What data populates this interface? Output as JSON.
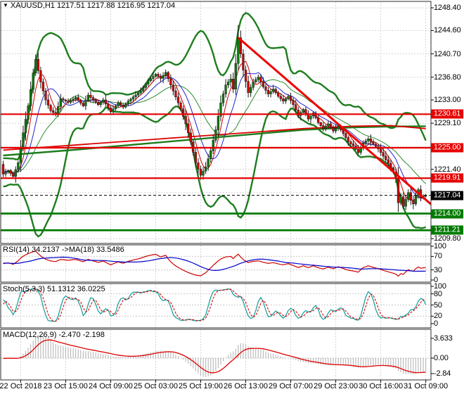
{
  "window": {
    "symbol_header": "XAUUSD,H1 1217.51 1217.88 1216.95 1217.04"
  },
  "colors": {
    "grid": "#d4d4d4",
    "pane_border": "#2b2b2b",
    "level_red": "#e60000",
    "level_green": "#007a00",
    "trendline_red": "#f00000",
    "bollinger_green": "#1e7d1e",
    "slow_ma_red": "#dd0000",
    "fast_ma_blue": "#2424cc",
    "candle_up": "#0c7c0c",
    "candle_down": "#d40000",
    "candle_border": "#1a1a1a",
    "rsi_line": "#cc0000",
    "rsi_ma": "#0000cc",
    "stoch_k": "#1fa3a3",
    "stoch_d": "#dd0000",
    "macd_hist": "#b0b0b0",
    "macd_signal": "#dd0000",
    "badge_black": "#000000"
  },
  "time_axis": {
    "labels": [
      "22 Oct 2018",
      "23 Oct 15:00",
      "24 Oct 09:00",
      "25 Oct 03:00",
      "25 Oct 19:00",
      "26 Oct 13:00",
      "29 Oct 07:00",
      "29 Oct 23:00",
      "30 Oct 16:00",
      "31 Oct 09:00"
    ],
    "tick_indices": [
      7,
      25,
      43,
      61,
      79,
      97,
      115,
      133,
      151,
      169
    ]
  },
  "price_axis": {
    "visible_ticks": [
      {
        "label": "1248.40",
        "value": 1248.4
      },
      {
        "label": "1244.60",
        "value": 1244.6
      },
      {
        "label": "1240.70",
        "value": 1240.7
      },
      {
        "label": "1236.80",
        "value": 1236.8
      },
      {
        "label": "1233.00",
        "value": 1233.0
      },
      {
        "label": "1229.10",
        "value": 1229.1
      },
      {
        "label": "1221.40",
        "value": 1221.4
      },
      {
        "label": "1209.80",
        "value": 1209.8
      }
    ],
    "all_tick_values": [
      1248.4,
      1244.6,
      1240.7,
      1236.8,
      1233.0,
      1229.1,
      1225.2,
      1221.4,
      1217.5,
      1213.6,
      1209.8
    ],
    "badges": [
      {
        "label": "1230.61",
        "value": 1230.61,
        "bg": "#e60000"
      },
      {
        "label": "1225.00",
        "value": 1225.0,
        "bg": "#e60000"
      },
      {
        "label": "1219.91",
        "value": 1219.91,
        "bg": "#e60000"
      },
      {
        "label": "1217.04",
        "value": 1217.04,
        "bg": "#000000"
      },
      {
        "label": "1214.00",
        "value": 1214.0,
        "bg": "#007a00"
      },
      {
        "label": "1211.21",
        "value": 1211.21,
        "bg": "#007a00"
      }
    ]
  },
  "chart_data": [
    {
      "type": "candlestick",
      "symbol": "XAUUSD",
      "timeframe": "H1",
      "ohlc_header": {
        "open": 1217.51,
        "high": 1217.88,
        "low": 1216.95,
        "close": 1217.04
      },
      "bars_count": 170,
      "ylim": [
        1209.1,
        1248.8
      ],
      "close_keypoints": [
        [
          0,
          1220.6
        ],
        [
          2,
          1221.2
        ],
        [
          4,
          1220.2
        ],
        [
          6,
          1222.5
        ],
        [
          8,
          1227.5
        ],
        [
          10,
          1232.0
        ],
        [
          12,
          1237.5
        ],
        [
          13,
          1239.8
        ],
        [
          15,
          1236.0
        ],
        [
          17,
          1233.0
        ],
        [
          19,
          1231.2
        ],
        [
          21,
          1230.6
        ],
        [
          23,
          1233.2
        ],
        [
          26,
          1232.6
        ],
        [
          29,
          1233.4
        ],
        [
          32,
          1232.0
        ],
        [
          34,
          1233.8
        ],
        [
          36,
          1233.0
        ],
        [
          38,
          1232.2
        ],
        [
          40,
          1233.0
        ],
        [
          43,
          1231.0
        ],
        [
          46,
          1232.5
        ],
        [
          48,
          1231.8
        ],
        [
          50,
          1232.8
        ],
        [
          52,
          1233.5
        ],
        [
          55,
          1234.5
        ],
        [
          58,
          1236.2
        ],
        [
          61,
          1237.3
        ],
        [
          63,
          1236.6
        ],
        [
          65,
          1237.6
        ],
        [
          67,
          1235.5
        ],
        [
          69,
          1233.5
        ],
        [
          71,
          1231.5
        ],
        [
          73,
          1229.0
        ],
        [
          75,
          1226.0
        ],
        [
          77,
          1222.5
        ],
        [
          79,
          1220.4
        ],
        [
          81,
          1221.8
        ],
        [
          83,
          1224.5
        ],
        [
          85,
          1228.0
        ],
        [
          87,
          1232.5
        ],
        [
          89,
          1235.5
        ],
        [
          91,
          1236.5
        ],
        [
          92,
          1234.8
        ],
        [
          94,
          1243.4
        ],
        [
          96,
          1238.0
        ],
        [
          98,
          1234.2
        ],
        [
          100,
          1236.0
        ],
        [
          102,
          1236.8
        ],
        [
          104,
          1235.2
        ],
        [
          106,
          1234.0
        ],
        [
          108,
          1234.8
        ],
        [
          110,
          1233.6
        ],
        [
          112,
          1232.8
        ],
        [
          114,
          1233.6
        ],
        [
          116,
          1232.2
        ],
        [
          118,
          1230.4
        ],
        [
          120,
          1231.4
        ],
        [
          122,
          1229.8
        ],
        [
          124,
          1230.8
        ],
        [
          126,
          1229.2
        ],
        [
          128,
          1228.2
        ],
        [
          130,
          1229.0
        ],
        [
          132,
          1227.8
        ],
        [
          134,
          1228.6
        ],
        [
          136,
          1227.4
        ],
        [
          138,
          1226.0
        ],
        [
          140,
          1225.3
        ],
        [
          142,
          1224.2
        ],
        [
          144,
          1225.8
        ],
        [
          146,
          1226.5
        ],
        [
          148,
          1225.6
        ],
        [
          150,
          1224.8
        ],
        [
          152,
          1223.6
        ],
        [
          154,
          1222.4
        ],
        [
          156,
          1220.9
        ],
        [
          157,
          1219.9
        ],
        [
          158,
          1215.8
        ],
        [
          159,
          1216.8
        ],
        [
          160,
          1215.2
        ],
        [
          161,
          1216.4
        ],
        [
          162,
          1217.5
        ],
        [
          163,
          1216.2
        ],
        [
          164,
          1215.6
        ],
        [
          165,
          1217.0
        ],
        [
          166,
          1218.0
        ],
        [
          167,
          1216.6
        ],
        [
          168,
          1216.9
        ],
        [
          169,
          1217.04
        ]
      ],
      "levels": {
        "red": [
          1230.61,
          1225.0,
          1219.91
        ],
        "green": [
          1214.0,
          1211.21
        ],
        "current": 1217.04
      },
      "trendline": {
        "points": [
          [
            94,
            1243.4
          ],
          [
            171.5,
            1215.4
          ]
        ]
      },
      "slow_ma_red": [
        [
          0,
          1224.6
        ],
        [
          30,
          1225.5
        ],
        [
          60,
          1226.4
        ],
        [
          90,
          1227.3
        ],
        [
          120,
          1228.2
        ],
        [
          140,
          1228.6
        ],
        [
          155,
          1228.7
        ],
        [
          169,
          1228.2
        ]
      ],
      "slow_ma_green": [
        [
          0,
          1223.7
        ],
        [
          30,
          1224.7
        ],
        [
          60,
          1225.8
        ],
        [
          90,
          1226.9
        ],
        [
          120,
          1228.0
        ],
        [
          140,
          1228.4
        ],
        [
          155,
          1228.55
        ],
        [
          169,
          1228.6
        ]
      ],
      "bollinger": {
        "period": 20,
        "deviation": 2.3
      },
      "fast_ma_periods": {
        "red": 5,
        "blue": 10,
        "green_mid": 20
      }
    },
    {
      "type": "line",
      "name": "RSI",
      "label": "RSI(14) 34.2137 ->MA(18) 33.5486",
      "period": 14,
      "ma_period": 18,
      "last_values": {
        "rsi": 34.2137,
        "ma": 33.5486
      },
      "range": [
        0,
        100
      ],
      "ticks": [
        {
          "label": "100",
          "value": 100
        },
        {
          "label": "70",
          "value": 70
        },
        {
          "label": "30",
          "value": 30
        },
        {
          "label": "0",
          "value": 0
        }
      ],
      "dashed_levels": [
        70,
        30
      ]
    },
    {
      "type": "line",
      "name": "Stochastic",
      "label": "Stoch(5,3,3) 51.1312 36.0225",
      "params": [
        5,
        3,
        3
      ],
      "last_values": {
        "k": 51.1312,
        "d": 36.0225
      },
      "range": [
        0,
        100
      ],
      "ticks": [
        {
          "label": "100",
          "value": 100
        },
        {
          "label": "80",
          "value": 80
        },
        {
          "label": "50",
          "value": 50
        },
        {
          "label": "20",
          "value": 20
        },
        {
          "label": "0",
          "value": 0
        }
      ],
      "dashed_levels": [
        80,
        50,
        20
      ]
    },
    {
      "type": "histogram+line",
      "name": "MACD",
      "label": "MACD(12,26,9) -2.470 -2.198",
      "params": [
        12,
        26,
        9
      ],
      "last_values": {
        "macd": -2.47,
        "signal": -2.198
      },
      "ticks": [
        {
          "label": "3.633",
          "value": 3.633
        },
        {
          "label": "0.00",
          "value": 0
        },
        {
          "label": "-2.84",
          "value": -2.84
        }
      ],
      "dashed_levels": [
        0
      ]
    }
  ]
}
